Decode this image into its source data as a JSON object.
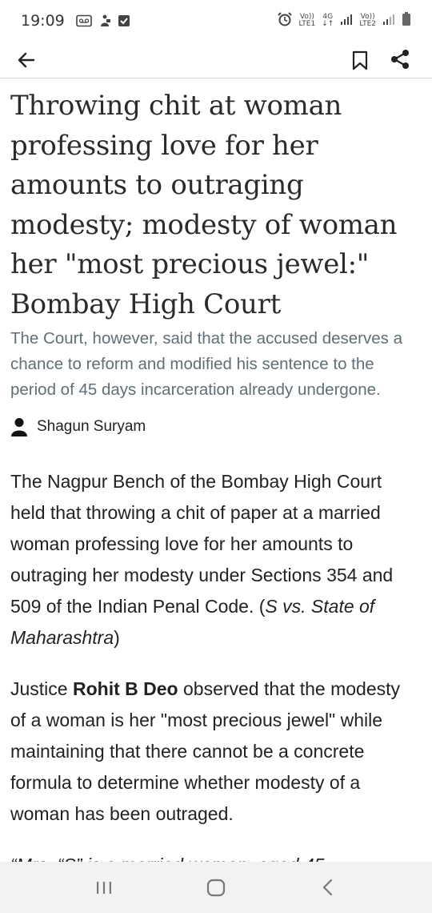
{
  "status_bar": {
    "time": "19:09",
    "icons": [
      "voicemail-icon",
      "sim-activity-icon",
      "checkbox-icon",
      "alarm-icon",
      "signal-icon",
      "battery-icon"
    ],
    "network_1_top": "Vo))",
    "network_1_bottom": "LTE1",
    "network_type": "4G",
    "network_2_top": "Vo))",
    "network_2_bottom": "LTE2"
  },
  "app_bar": {
    "icons": [
      "back-arrow-icon",
      "bookmark-icon",
      "share-icon"
    ]
  },
  "article": {
    "title": "Throwing chit at woman professing love for her amounts to outraging modesty; modesty of woman her \"most precious jewel:\" Bombay High Court",
    "subtitle": "The Court, however, said that the accused deserves a chance to reform and modified his sentence to the period of 45 days incarceration already undergone.",
    "author": "Shagun Suryam",
    "p1_text": "The Nagpur Bench of the Bombay High Court held that throwing a chit of paper at a married woman professing love for her amounts to outraging her modesty under Sections 354 and 509 of the Indian Penal Code. (",
    "p1_case": "S vs. State of Maharashtra",
    "p1_close": ")",
    "p2_pre": "Justice ",
    "p2_judge": "Rohit B Deo",
    "p2_post": " observed that the modesty of a woman is her \"most precious jewel\" while maintaining that there cannot be a concrete formula to determine whether modesty of a woman has been outraged.",
    "p3_quote": "“Mrs. “S” is a married woman, aged 45"
  },
  "nav_bar": {
    "buttons": [
      "recent-apps-icon",
      "home-icon",
      "back-icon"
    ]
  },
  "colors": {
    "subtitle": "#5f6f78",
    "divider": "#d6d6d6",
    "nav_background": "#f2f2f2"
  }
}
